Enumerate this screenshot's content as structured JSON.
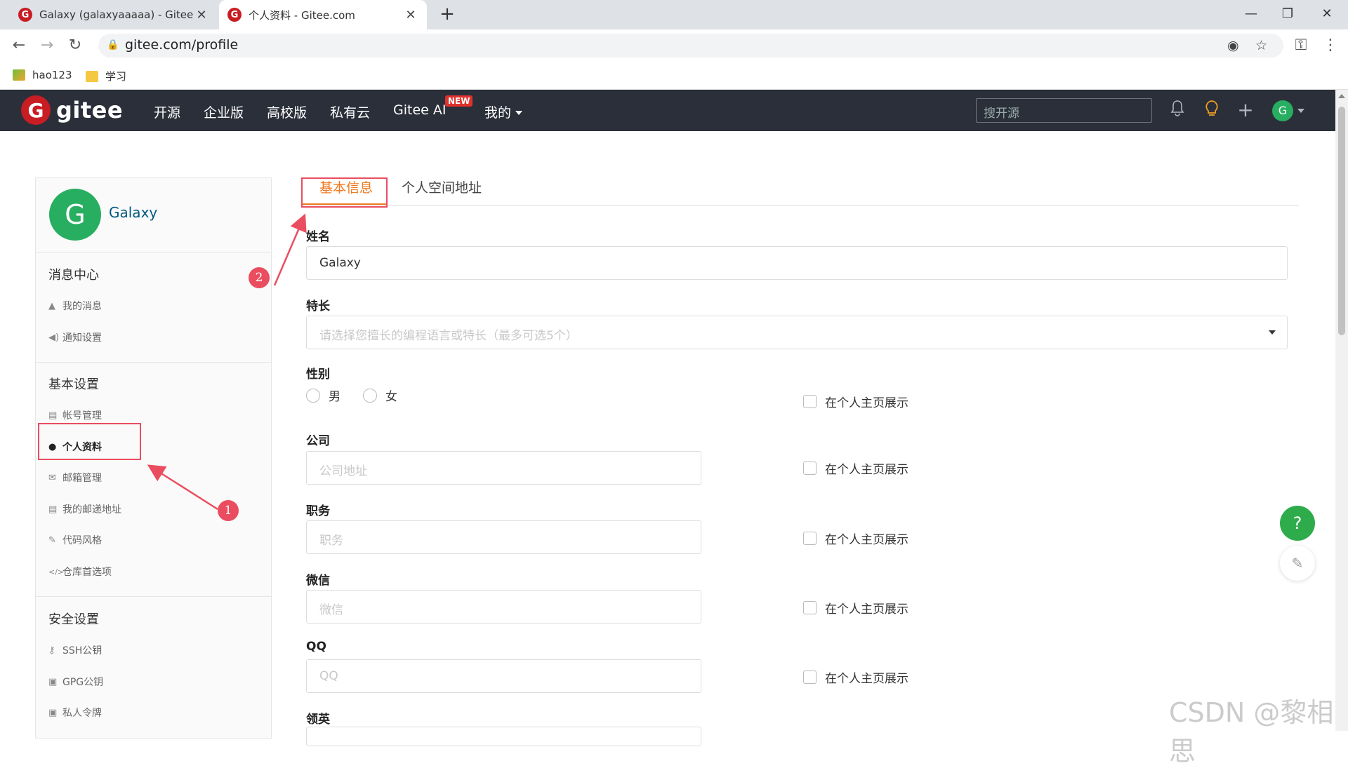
{
  "browser": {
    "tabs": [
      {
        "title": "Galaxy (galaxyaaaaa) - Gitee.co",
        "favicon": "G"
      },
      {
        "title": "个人资料 - Gitee.com",
        "favicon": "G"
      }
    ],
    "url": "gitee.com/profile",
    "bookmarks": [
      "hao123",
      "学习"
    ],
    "close_glyph": "✕",
    "new_tab_glyph": "+",
    "window_controls": [
      "—",
      "❐",
      "✕"
    ],
    "icons": {
      "back": "←",
      "forward": "→",
      "reload": "↻",
      "lock": "🔒",
      "eye_off": "◉",
      "star": "☆",
      "key": "⚿",
      "menu": "⋮"
    }
  },
  "header": {
    "logo_letter": "G",
    "logo_word": "gitee",
    "nav": [
      "开源",
      "企业版",
      "高校版",
      "私有云",
      "Gitee AI",
      "我的"
    ],
    "new_badge": "NEW",
    "search_placeholder": "搜开源",
    "avatar_letter": "G",
    "icons": {
      "bell": "🔔",
      "bulb": "💡",
      "plus": "+"
    }
  },
  "sidebar": {
    "avatar_letter": "G",
    "user_name": "Galaxy",
    "sections": [
      {
        "title": "消息中心",
        "items": [
          {
            "icon": "bell-icon",
            "glyph": "▲",
            "label": "我的消息"
          },
          {
            "icon": "speaker-icon",
            "glyph": "◀)",
            "label": "通知设置"
          }
        ]
      },
      {
        "title": "基本设置",
        "items": [
          {
            "icon": "id-card-icon",
            "glyph": "▤",
            "label": "帐号管理"
          },
          {
            "icon": "user-icon",
            "glyph": "●",
            "label": "个人资料"
          },
          {
            "icon": "envelope-icon",
            "glyph": "✉",
            "label": "邮箱管理"
          },
          {
            "icon": "address-card-icon",
            "glyph": "▤",
            "label": "我的邮递地址"
          },
          {
            "icon": "brush-icon",
            "glyph": "✎",
            "label": "代码风格"
          },
          {
            "icon": "code-icon",
            "glyph": "</>",
            "label": "仓库首选项"
          }
        ]
      },
      {
        "title": "安全设置",
        "items": [
          {
            "icon": "key-icon",
            "glyph": "⚷",
            "label": "SSH公钥"
          },
          {
            "icon": "lock-icon",
            "glyph": "▣",
            "label": "GPG公钥"
          },
          {
            "icon": "token-icon",
            "glyph": "▣",
            "label": "私人令牌"
          }
        ]
      }
    ],
    "active_item": "个人资料"
  },
  "main": {
    "tabs": [
      "基本信息",
      "个人空间地址"
    ],
    "fields": {
      "name": {
        "label": "姓名",
        "value": "Galaxy"
      },
      "skills": {
        "label": "特长",
        "placeholder": "请选择您擅长的编程语言或特长（最多可选5个）"
      },
      "gender": {
        "label": "性别",
        "options": [
          "男",
          "女"
        ]
      },
      "company": {
        "label": "公司",
        "placeholder": "公司地址"
      },
      "position": {
        "label": "职务",
        "placeholder": "职务"
      },
      "wechat": {
        "label": "微信",
        "placeholder": "微信"
      },
      "qq": {
        "label": "QQ",
        "placeholder": "QQ"
      },
      "linkedin": {
        "label": "领英"
      }
    },
    "show_on_profile": "在个人主页展示"
  },
  "annotations": {
    "num1": "1",
    "num2": "2",
    "color": "#ea4d5f"
  },
  "floating": {
    "help": "?",
    "feedback": "✎"
  },
  "watermark": "CSDN @黎相思",
  "colors": {
    "brand": "#c71d23",
    "header_bg": "#2b2f3a",
    "active_tab": "#f0791e",
    "avatar": "#27ae60",
    "link": "#005980"
  }
}
